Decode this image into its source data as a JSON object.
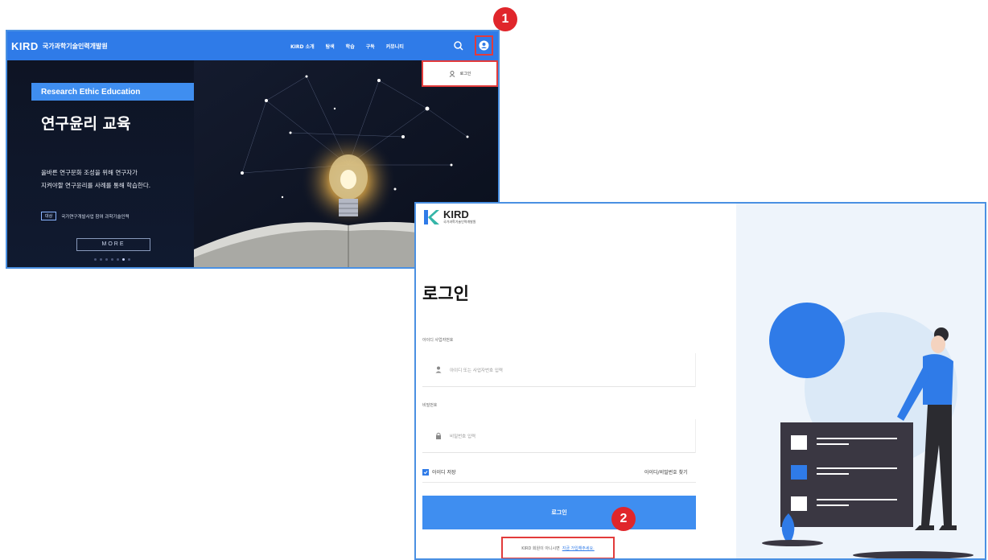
{
  "home": {
    "logo": "KIRD",
    "logo_sub": "국가과학기술인력개발원",
    "nav": [
      "KIRD 소개",
      "탐색",
      "학습",
      "구독",
      "커뮤니티"
    ],
    "dropdown_login": "로그인",
    "hero": {
      "tag": "Research Ethic Education",
      "title": "연구윤리 교육",
      "desc_line1": "올바른 연구문화 조성을 위해 연구자가",
      "desc_line2": "지켜야할 연구윤리를 사례를 통해 학습한다.",
      "badge_chip": "대상",
      "badge_text": "국가연구개발사업 참여 과학기술인력",
      "more": "MORE"
    }
  },
  "login": {
    "logo": "KIRD",
    "logo_sub": "국가과학기술인력개발원",
    "title": "로그인",
    "id_label": "아이디 사업자번호",
    "id_placeholder": "아이디 또는 사업자번호 입력",
    "pw_label": "비밀번호",
    "pw_placeholder": "비밀번호 입력",
    "remember": "아이디 저장",
    "find": "아이디/비밀번호 찾기",
    "button": "로그인",
    "signup_question": "KIRD 회원이 아니시면",
    "signup_link": "지금 가입해주세요."
  },
  "steps": [
    "1",
    "2"
  ],
  "colors": {
    "accent": "#2f7be8",
    "highlight": "#e23b3b",
    "marker": "#e0262b"
  }
}
